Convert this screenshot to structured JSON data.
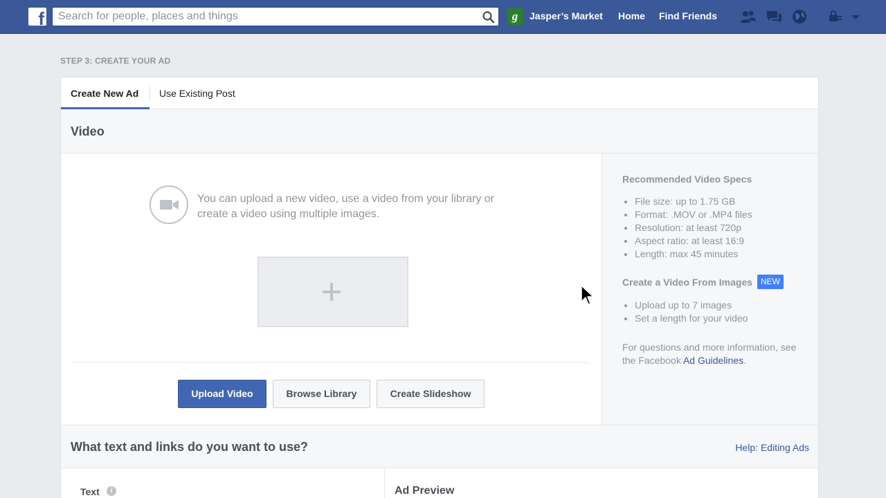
{
  "topbar": {
    "logo": "f",
    "search_placeholder": "Search for people, places and things",
    "page_avatar_letter": "g",
    "page_name": "Jasper’s Market",
    "home_label": "Home",
    "find_friends_label": "Find Friends",
    "icons": [
      "friend-requests-icon",
      "messages-icon",
      "notifications-icon",
      "privacy-shortcuts-icon",
      "account-menu-chevron-icon"
    ]
  },
  "step": {
    "title": "STEP 3: CREATE YOUR AD"
  },
  "tabs": [
    {
      "label": "Create New Ad",
      "active": true
    },
    {
      "label": "Use Existing Post",
      "active": false
    }
  ],
  "video": {
    "heading": "Video",
    "message": "You can upload a new video, use a video from your library or create a video using multiple images.",
    "buttons": {
      "upload": "Upload Video",
      "browse": "Browse Library",
      "slideshow": "Create Slideshow"
    }
  },
  "specs": {
    "heading": "Recommended Video Specs",
    "items": [
      "File size: up to 1.75 GB",
      "Format: .MOV or .MP4 files",
      "Resolution: at least 720p",
      "Aspect ratio: at least 16:9",
      "Length: max 45 minutes"
    ],
    "images_heading": "Create a Video From Images",
    "new_badge": "NEW",
    "images_items": [
      "Upload up to 7 images",
      "Set a length for your video"
    ],
    "info_prefix": "For questions and more information, see the Facebook ",
    "info_link": "Ad Guidelines",
    "info_suffix": "."
  },
  "text_section": {
    "heading": "What text and links do you want to use?",
    "help_link": "Help: Editing Ads",
    "text_label": "Text",
    "preview_heading": "Ad Preview"
  },
  "colors": {
    "brand": "#3b5998",
    "primary_button": "#4267b2",
    "link": "#365899",
    "badge": "#4080ff"
  }
}
